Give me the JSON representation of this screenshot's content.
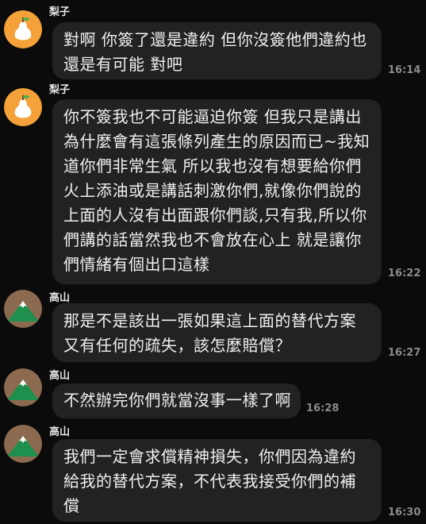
{
  "messages": [
    {
      "sender": "梨子",
      "avatar_icon": "pear-avatar-icon",
      "lines": [
        "對啊 你簽了還是違約 但你沒簽他們違約也",
        "還是有可能 對吧"
      ],
      "time": "16:14"
    },
    {
      "sender": "梨子",
      "avatar_icon": "pear-avatar-icon",
      "lines": [
        "你不簽我也不可能逼迫你簽 但我只是講出",
        "為什麼會有這張條列產生的原因而已~我知",
        "道你們非常生氣 所以我也沒有想要給你們",
        "火上添油或是講話刺激你們,就像你們說的",
        "上面的人沒有出面跟你們談,只有我,所以你",
        "們講的話當然我也不會放在心上 就是讓你",
        "們情緒有個出口這樣"
      ],
      "time": "16:22"
    },
    {
      "sender": "高山",
      "avatar_icon": "mountain-avatar-icon",
      "lines": [
        "那是不是該出一張如果這上面的替代方案",
        "又有任何的疏失，該怎麼賠償？"
      ],
      "time": "16:27"
    },
    {
      "sender": "高山",
      "avatar_icon": "mountain-avatar-icon",
      "lines": [
        "不然辦完你們就當沒事一樣了啊"
      ],
      "time": "16:28"
    },
    {
      "sender": "高山",
      "avatar_icon": "mountain-avatar-icon",
      "lines": [
        "我們一定會求償精神損失，你們因為違約",
        "給我的替代方案，不代表我接受你們的補",
        "償"
      ],
      "time": "16:30"
    }
  ],
  "colors": {
    "background": "#0b0b0b",
    "bubble": "#222222",
    "pear_avatar_bg": "#f4a13a",
    "mountain_avatar_bg": "#8c6a4f",
    "mountain_green": "#1f8f4e"
  }
}
